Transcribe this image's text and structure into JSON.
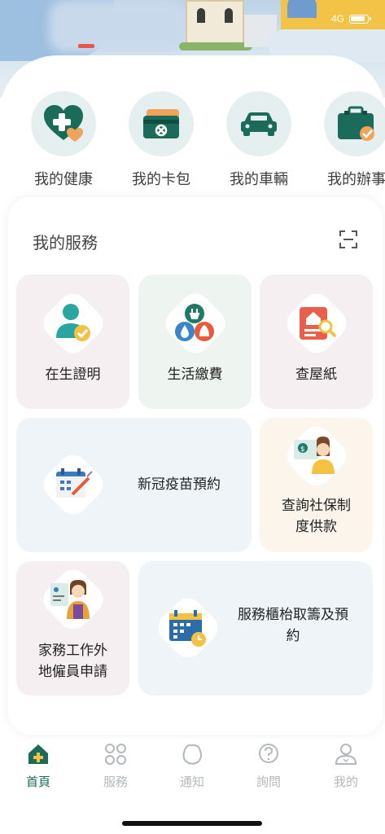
{
  "status_bar": {
    "network": "4G"
  },
  "quick_actions": [
    {
      "label": "我的健康",
      "icon": "health-heart-icon"
    },
    {
      "label": "我的卡包",
      "icon": "card-wallet-icon"
    },
    {
      "label": "我的車輛",
      "icon": "car-icon"
    },
    {
      "label": "我的辦事",
      "icon": "briefcase-icon"
    }
  ],
  "services": {
    "title": "我的服務",
    "scan_icon": "scan-icon",
    "tiles": [
      {
        "label": "在生證明",
        "icon": "person-check-icon",
        "bg": "#f6eff2"
      },
      {
        "label": "生活繳費",
        "icon": "utility-bills-icon",
        "bg": "#eef5f1"
      },
      {
        "label": "查屋紙",
        "icon": "property-search-icon",
        "bg": "#f6eff2"
      },
      {
        "label": "新冠疫苗預約",
        "icon": "vaccine-calendar-icon",
        "bg": "#eef4f8"
      },
      {
        "label_lines": [
          "查詢社保制",
          "度供款"
        ],
        "icon": "social-security-icon",
        "bg": "#fbf5ec"
      },
      {
        "label_lines": [
          "家務工作外",
          "地僱員申請"
        ],
        "icon": "domestic-helper-icon",
        "bg": "#f6eff2"
      },
      {
        "label_lines": [
          "服務櫃枱取籌及預",
          "約"
        ],
        "icon": "counter-booking-icon",
        "bg": "#eef4f8"
      }
    ]
  },
  "colors": {
    "primary": "#1a6b5a",
    "accent": "#f2a35a",
    "inactive": "#b3b8bc"
  },
  "bottom_nav": [
    {
      "label": "首頁",
      "icon": "home-icon",
      "active": true
    },
    {
      "label": "服務",
      "icon": "services-grid-icon",
      "active": false
    },
    {
      "label": "通知",
      "icon": "notification-icon",
      "active": false
    },
    {
      "label": "詢問",
      "icon": "question-icon",
      "active": false
    },
    {
      "label": "我的",
      "icon": "profile-icon",
      "active": false
    }
  ]
}
